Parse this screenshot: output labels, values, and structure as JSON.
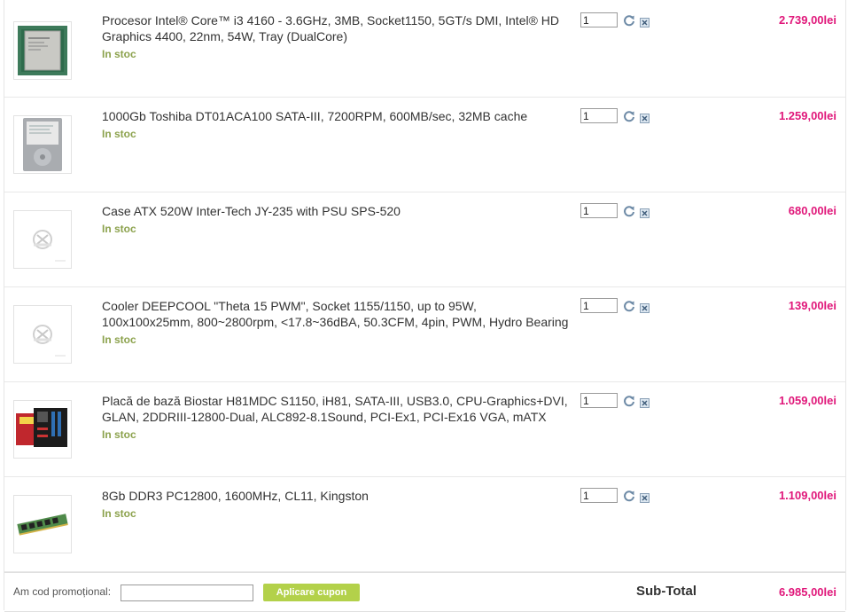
{
  "items": [
    {
      "title": "Procesor Intel® Core™ i3 4160 - 3.6GHz, 3MB, Socket1150, 5GT/s DMI, Intel® HD Graphics 4400, 22nm, 54W, Tray (DualCore)",
      "stock": "In stoc",
      "qty": "1",
      "price": "2.739,00lei",
      "image": "cpu-image"
    },
    {
      "title": "1000Gb Toshiba DT01ACA100 SATA-III, 7200RPM, 600MB/sec, 32MB cache",
      "stock": "In stoc",
      "qty": "1",
      "price": "1.259,00lei",
      "image": "hdd-image"
    },
    {
      "title": "Case ATX 520W Inter-Tech JY-235 with PSU SPS-520",
      "stock": "In stoc",
      "qty": "1",
      "price": "680,00lei",
      "image": "placeholder-image"
    },
    {
      "title": "Cooler DEEPCOOL \"Theta 15 PWM\", Socket 1155/1150, up to 95W, 100x100x25mm, 800~2800rpm, <17.8~36dBA, 50.3CFM, 4pin, PWM, Hydro Bearing",
      "stock": "In stoc",
      "qty": "1",
      "price": "139,00lei",
      "image": "placeholder-image"
    },
    {
      "title": "Placă de bază Biostar H81MDC S1150, iH81, SATA-III, USB3.0, CPU-Graphics+DVI, GLAN, 2DDRIII-12800-Dual, ALC892-8.1Sound, PCI-Ex1, PCI-Ex16 VGA, mATX",
      "stock": "In stoc",
      "qty": "1",
      "price": "1.059,00lei",
      "image": "motherboard-image"
    },
    {
      "title": "8Gb DDR3 PC12800, 1600MHz, CL11, Kingston",
      "stock": "In stoc",
      "qty": "1",
      "price": "1.109,00lei",
      "image": "ram-image"
    }
  ],
  "promo": {
    "label": "Am cod promoțional:",
    "value": "",
    "button_label": "Aplicare cupon"
  },
  "subtotal": {
    "label": "Sub-Total",
    "value": "6.985,00lei"
  },
  "icons": {
    "refresh": "refresh-icon",
    "remove": "remove-icon"
  },
  "colors": {
    "price": "#e0177a",
    "stock": "#8ca24d",
    "button": "#b3d14a"
  }
}
